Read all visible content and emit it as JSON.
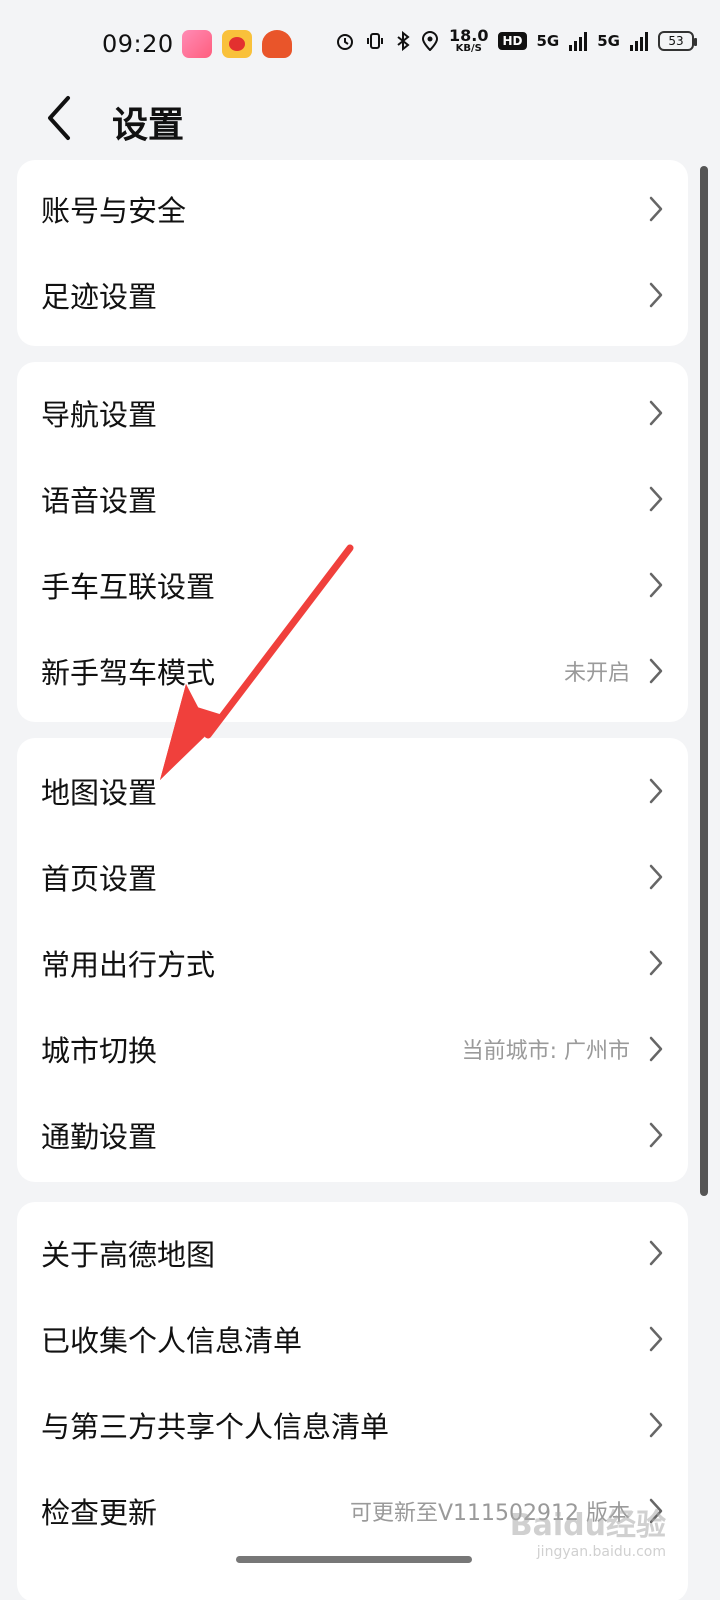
{
  "status_bar": {
    "time": "09:20",
    "speed_value": "18.0",
    "speed_unit": "KB/S",
    "hd_label": "HD",
    "network1": "5G",
    "network2": "5G",
    "battery": "53",
    "icons": [
      "alarm-icon",
      "vibrate-icon",
      "bluetooth-icon",
      "location-icon"
    ]
  },
  "header": {
    "title": "设置"
  },
  "groups": [
    {
      "items": [
        {
          "label": "账号与安全",
          "value": ""
        },
        {
          "label": "足迹设置",
          "value": ""
        }
      ]
    },
    {
      "items": [
        {
          "label": "导航设置",
          "value": ""
        },
        {
          "label": "语音设置",
          "value": ""
        },
        {
          "label": "手车互联设置",
          "value": ""
        },
        {
          "label": "新手驾车模式",
          "value": "未开启"
        }
      ]
    },
    {
      "items": [
        {
          "label": "地图设置",
          "value": ""
        },
        {
          "label": "首页设置",
          "value": ""
        },
        {
          "label": "常用出行方式",
          "value": ""
        },
        {
          "label": "城市切换",
          "value": "当前城市: 广州市"
        },
        {
          "label": "通勤设置",
          "value": ""
        }
      ]
    },
    {
      "items": [
        {
          "label": "关于高德地图",
          "value": ""
        },
        {
          "label": "已收集个人信息清单",
          "value": ""
        },
        {
          "label": "与第三方共享个人信息清单",
          "value": ""
        },
        {
          "label": "检查更新",
          "value": "可更新至V111502912 版本"
        }
      ]
    }
  ],
  "watermark": {
    "text": "Baidu经验",
    "sub": "jingyan.baidu.com"
  },
  "colors": {
    "background": "#f3f4f6",
    "card": "#ffffff",
    "annotation_arrow": "#f0403c"
  }
}
